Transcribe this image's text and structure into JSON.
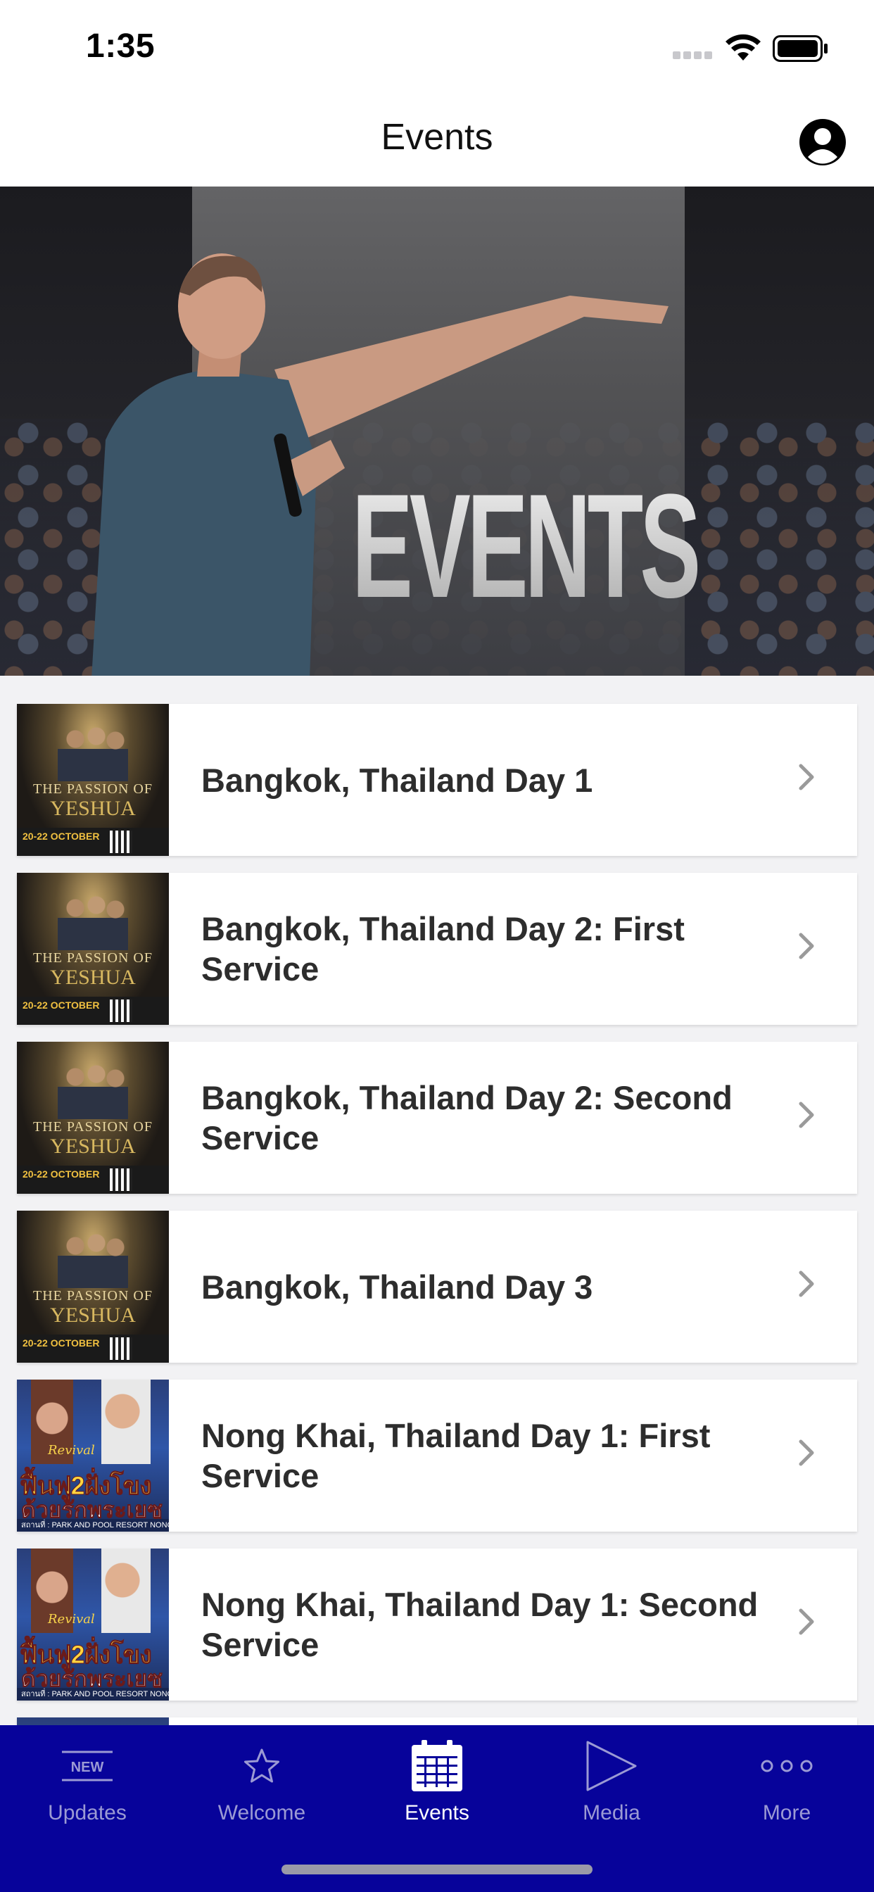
{
  "status_bar": {
    "time": "1:35",
    "signal_icon": "cellular-signal-icon",
    "wifi_icon": "wifi-icon",
    "battery_icon": "battery-icon"
  },
  "header": {
    "title": "Events",
    "profile_icon": "profile-icon"
  },
  "hero": {
    "text": "EVENTS"
  },
  "events": [
    {
      "title": "Bangkok, Thailand Day 1",
      "thumbnail": {
        "title": "THE PASSION OF",
        "name": "YESHUA",
        "date": "20-22 OCTOBER"
      }
    },
    {
      "title": "Bangkok, Thailand Day 2: First Service",
      "thumbnail": {
        "title": "THE PASSION OF",
        "name": "YESHUA",
        "date": "20-22 OCTOBER"
      }
    },
    {
      "title": "Bangkok, Thailand Day 2: Second Service",
      "thumbnail": {
        "title": "THE PASSION OF",
        "name": "YESHUA",
        "date": "20-22 OCTOBER"
      }
    },
    {
      "title": "Bangkok, Thailand Day 3",
      "thumbnail": {
        "title": "THE PASSION OF",
        "name": "YESHUA",
        "date": "20-22 OCTOBER"
      }
    },
    {
      "title": "Nong Khai, Thailand Day 1: First Service",
      "thumbnail": {
        "script": "Revival",
        "line1": "ฟื้นฟู2ฝั่งโขง",
        "line2": "ด้วยรักพระเยซู",
        "footer": "สถานที่ : PARK AND POOL RESORT NONGKAI"
      }
    },
    {
      "title": "Nong Khai, Thailand Day 1: Second Service",
      "thumbnail": {
        "script": "Revival",
        "line1": "ฟื้นฟู2ฝั่งโขง",
        "line2": "ด้วยรักพระเยซู",
        "footer": "สถานที่ : PARK AND POOL RESORT NONGKAI"
      }
    }
  ],
  "tab_bar": {
    "tabs": [
      {
        "label": "Updates",
        "icon": "new-badge-icon",
        "active": false
      },
      {
        "label": "Welcome",
        "icon": "star-icon",
        "active": false
      },
      {
        "label": "Events",
        "icon": "calendar-icon",
        "active": true
      },
      {
        "label": "Media",
        "icon": "play-icon",
        "active": false
      },
      {
        "label": "More",
        "icon": "more-dots-icon",
        "active": false
      }
    ],
    "new_badge_text": "NEW"
  },
  "colors": {
    "tab_bar_bg": "#07039a",
    "tab_inactive": "#9b9ad4",
    "tab_active": "#ffffff"
  }
}
